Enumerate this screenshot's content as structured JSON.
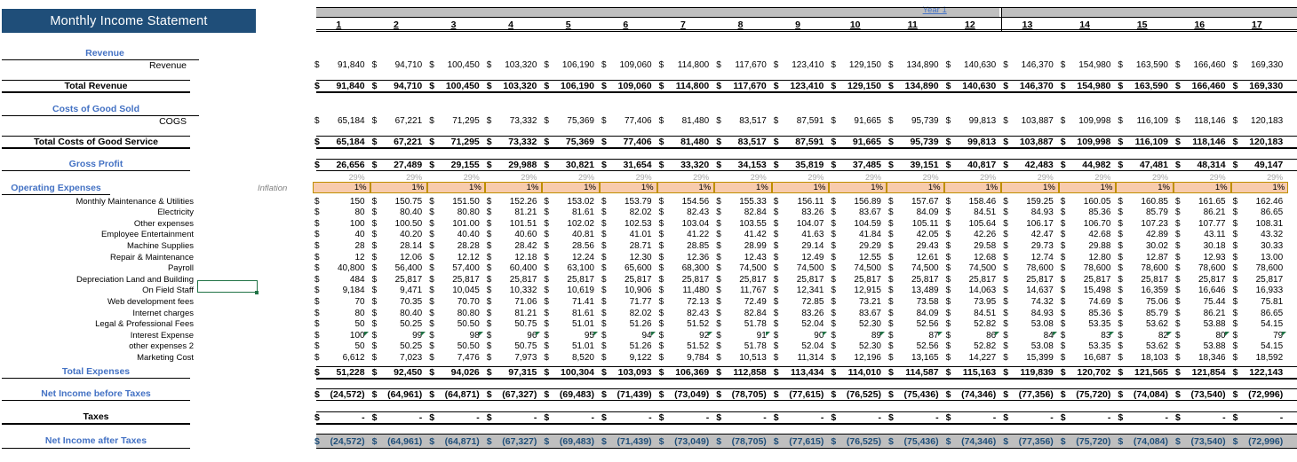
{
  "app": {
    "title": "Monthly Income Statement",
    "accent_blue": "#1F4E79",
    "section_blue": "#4472C4",
    "inflation_fill": "#F8CBAD",
    "header_band": "#BFBFBF"
  },
  "sections": {
    "revenue": "Revenue",
    "total_revenue": "Total Revenue",
    "cogs_header": "Costs of Good Sold",
    "total_cogs": "Total Costs of Good Service",
    "gross_profit": "Gross Profit",
    "operating_expenses": "Operating Expenses",
    "total_expenses": "Total Expenses",
    "net_before_taxes": "Net Income before Taxes",
    "taxes": "Taxes",
    "net_after_taxes": "Net Income after Taxes",
    "inflation_label": "Inflation"
  },
  "items": {
    "revenue": "Revenue",
    "cogs": "COGS"
  },
  "expense_labels": [
    "Monthly Maintenance & Utilities",
    "Electricity",
    "Other expenses",
    "Employee Entertainment",
    "Machine Supplies",
    "Repair & Maintenance",
    "Payroll",
    "Depreciation Land and Building",
    "On Field Staff",
    "Web development fees",
    "Internet charges",
    "Legal & Professional Fees",
    "Interest Expense",
    "other expenses 2",
    "Marketing Cost"
  ],
  "grid": {
    "year_label": "Year 1",
    "columns": [
      "1",
      "2",
      "3",
      "4",
      "5",
      "6",
      "7",
      "8",
      "9",
      "10",
      "11",
      "12",
      "13",
      "14",
      "15",
      "16",
      "17"
    ],
    "year_break_after_column": 12,
    "margin_pct_row": [
      "29%",
      "29%",
      "29%",
      "29%",
      "29%",
      "29%",
      "29%",
      "29%",
      "29%",
      "29%",
      "29%",
      "29%",
      "29%",
      "29%",
      "29%",
      "29%",
      "29%"
    ],
    "inflation_row": [
      "1%",
      "1%",
      "1%",
      "1%",
      "1%",
      "1%",
      "1%",
      "1%",
      "1%",
      "1%",
      "1%",
      "1%",
      "1%",
      "1%",
      "1%",
      "1%",
      "1%"
    ],
    "currency_symbol": "$",
    "zero_dash": "-"
  },
  "chart_data": {
    "type": "table",
    "title": "Monthly Income Statement",
    "categories": [
      "1",
      "2",
      "3",
      "4",
      "5",
      "6",
      "7",
      "8",
      "9",
      "10",
      "11",
      "12",
      "13",
      "14",
      "15",
      "16",
      "17"
    ],
    "series": [
      {
        "name": "Revenue",
        "values": [
          "91,840",
          "94,710",
          "100,450",
          "103,320",
          "106,190",
          "109,060",
          "114,800",
          "117,670",
          "123,410",
          "129,150",
          "134,890",
          "140,630",
          "146,370",
          "154,980",
          "163,590",
          "166,460",
          "169,330"
        ]
      },
      {
        "name": "Total Revenue",
        "values": [
          "91,840",
          "94,710",
          "100,450",
          "103,320",
          "106,190",
          "109,060",
          "114,800",
          "117,670",
          "123,410",
          "129,150",
          "134,890",
          "140,630",
          "146,370",
          "154,980",
          "163,590",
          "166,460",
          "169,330"
        ]
      },
      {
        "name": "COGS",
        "values": [
          "65,184",
          "67,221",
          "71,295",
          "73,332",
          "75,369",
          "77,406",
          "81,480",
          "83,517",
          "87,591",
          "91,665",
          "95,739",
          "99,813",
          "103,887",
          "109,998",
          "116,109",
          "118,146",
          "120,183"
        ]
      },
      {
        "name": "Total Costs of Good Service",
        "values": [
          "65,184",
          "67,221",
          "71,295",
          "73,332",
          "75,369",
          "77,406",
          "81,480",
          "83,517",
          "87,591",
          "91,665",
          "95,739",
          "99,813",
          "103,887",
          "109,998",
          "116,109",
          "118,146",
          "120,183"
        ]
      },
      {
        "name": "Gross Profit",
        "values": [
          "26,656",
          "27,489",
          "29,155",
          "29,988",
          "30,821",
          "31,654",
          "33,320",
          "34,153",
          "35,819",
          "37,485",
          "39,151",
          "40,817",
          "42,483",
          "44,982",
          "47,481",
          "48,314",
          "49,147"
        ]
      },
      {
        "name": "Monthly Maintenance & Utilities",
        "values": [
          "150",
          "150.75",
          "151.50",
          "152.26",
          "153.02",
          "153.79",
          "154.56",
          "155.33",
          "156.11",
          "156.89",
          "157.67",
          "158.46",
          "159.25",
          "160.05",
          "160.85",
          "161.65",
          "162.46"
        ]
      },
      {
        "name": "Electricity",
        "values": [
          "80",
          "80.40",
          "80.80",
          "81.21",
          "81.61",
          "82.02",
          "82.43",
          "82.84",
          "83.26",
          "83.67",
          "84.09",
          "84.51",
          "84.93",
          "85.36",
          "85.79",
          "86.21",
          "86.65"
        ]
      },
      {
        "name": "Other expenses",
        "values": [
          "100",
          "100.50",
          "101.00",
          "101.51",
          "102.02",
          "102.53",
          "103.04",
          "103.55",
          "104.07",
          "104.59",
          "105.11",
          "105.64",
          "106.17",
          "106.70",
          "107.23",
          "107.77",
          "108.31"
        ]
      },
      {
        "name": "Employee Entertainment",
        "values": [
          "40",
          "40.20",
          "40.40",
          "40.60",
          "40.81",
          "41.01",
          "41.22",
          "41.42",
          "41.63",
          "41.84",
          "42.05",
          "42.26",
          "42.47",
          "42.68",
          "42.89",
          "43.11",
          "43.32"
        ]
      },
      {
        "name": "Machine Supplies",
        "values": [
          "28",
          "28.14",
          "28.28",
          "28.42",
          "28.56",
          "28.71",
          "28.85",
          "28.99",
          "29.14",
          "29.29",
          "29.43",
          "29.58",
          "29.73",
          "29.88",
          "30.02",
          "30.18",
          "30.33"
        ]
      },
      {
        "name": "Repair & Maintenance",
        "values": [
          "12",
          "12.06",
          "12.12",
          "12.18",
          "12.24",
          "12.30",
          "12.36",
          "12.43",
          "12.49",
          "12.55",
          "12.61",
          "12.68",
          "12.74",
          "12.80",
          "12.87",
          "12.93",
          "13.00"
        ]
      },
      {
        "name": "Payroll",
        "values": [
          "40,800",
          "56,400",
          "57,400",
          "60,400",
          "63,100",
          "65,600",
          "68,300",
          "74,500",
          "74,500",
          "74,500",
          "74,500",
          "74,500",
          "78,600",
          "78,600",
          "78,600",
          "78,600",
          "78,600"
        ]
      },
      {
        "name": "Depreciation Land and Building",
        "values": [
          "484",
          "25,817",
          "25,817",
          "25,817",
          "25,817",
          "25,817",
          "25,817",
          "25,817",
          "25,817",
          "25,817",
          "25,817",
          "25,817",
          "25,817",
          "25,817",
          "25,817",
          "25,817",
          "25,817"
        ]
      },
      {
        "name": "On Field Staff",
        "values": [
          "9,184",
          "9,471",
          "10,045",
          "10,332",
          "10,619",
          "10,906",
          "11,480",
          "11,767",
          "12,341",
          "12,915",
          "13,489",
          "14,063",
          "14,637",
          "15,498",
          "16,359",
          "16,646",
          "16,933"
        ]
      },
      {
        "name": "Web development fees",
        "values": [
          "70",
          "70.35",
          "70.70",
          "71.06",
          "71.41",
          "71.77",
          "72.13",
          "72.49",
          "72.85",
          "73.21",
          "73.58",
          "73.95",
          "74.32",
          "74.69",
          "75.06",
          "75.44",
          "75.81"
        ]
      },
      {
        "name": "Internet charges",
        "values": [
          "80",
          "80.40",
          "80.80",
          "81.21",
          "81.61",
          "82.02",
          "82.43",
          "82.84",
          "83.26",
          "83.67",
          "84.09",
          "84.51",
          "84.93",
          "85.36",
          "85.79",
          "86.21",
          "86.65"
        ]
      },
      {
        "name": "Legal & Professional Fees",
        "values": [
          "50",
          "50.25",
          "50.50",
          "50.75",
          "51.01",
          "51.26",
          "51.52",
          "51.78",
          "52.04",
          "52.30",
          "52.56",
          "52.82",
          "53.08",
          "53.35",
          "53.62",
          "53.88",
          "54.15"
        ]
      },
      {
        "name": "Interest Expense",
        "values": [
          "100",
          "99",
          "98",
          "96",
          "95",
          "94",
          "92",
          "91",
          "90",
          "89",
          "87",
          "86",
          "84",
          "83",
          "82",
          "80",
          "79"
        ]
      },
      {
        "name": "other expenses 2",
        "values": [
          "50",
          "50.25",
          "50.50",
          "50.75",
          "51.01",
          "51.26",
          "51.52",
          "51.78",
          "52.04",
          "52.30",
          "52.56",
          "52.82",
          "53.08",
          "53.35",
          "53.62",
          "53.88",
          "54.15"
        ]
      },
      {
        "name": "Marketing Cost",
        "values": [
          "6,612",
          "7,023",
          "7,476",
          "7,973",
          "8,520",
          "9,122",
          "9,784",
          "10,513",
          "11,314",
          "12,196",
          "13,165",
          "14,227",
          "15,399",
          "16,687",
          "18,103",
          "18,346",
          "18,592"
        ]
      },
      {
        "name": "Total Expenses",
        "values": [
          "51,228",
          "92,450",
          "94,026",
          "97,315",
          "100,304",
          "103,093",
          "106,369",
          "112,858",
          "113,434",
          "114,010",
          "114,587",
          "115,163",
          "119,839",
          "120,702",
          "121,565",
          "121,854",
          "122,143"
        ]
      },
      {
        "name": "Net Income before Taxes",
        "values": [
          "(24,572)",
          "(64,961)",
          "(64,871)",
          "(67,327)",
          "(69,483)",
          "(71,439)",
          "(73,049)",
          "(78,705)",
          "(77,615)",
          "(76,525)",
          "(75,436)",
          "(74,346)",
          "(77,356)",
          "(75,720)",
          "(74,084)",
          "(73,540)",
          "(72,996)"
        ]
      },
      {
        "name": "Taxes",
        "values": [
          "-",
          "-",
          "-",
          "-",
          "-",
          "-",
          "-",
          "-",
          "-",
          "-",
          "-",
          "-",
          "-",
          "-",
          "-",
          "-",
          "-"
        ]
      },
      {
        "name": "Net Income after Taxes",
        "values": [
          "(24,572)",
          "(64,961)",
          "(64,871)",
          "(67,327)",
          "(69,483)",
          "(71,439)",
          "(73,049)",
          "(78,705)",
          "(77,615)",
          "(76,525)",
          "(75,436)",
          "(74,346)",
          "(77,356)",
          "(75,720)",
          "(74,084)",
          "(73,540)",
          "(72,996)"
        ]
      }
    ]
  },
  "selection": {
    "cell_value": "",
    "row_label": "On Field Staff"
  }
}
